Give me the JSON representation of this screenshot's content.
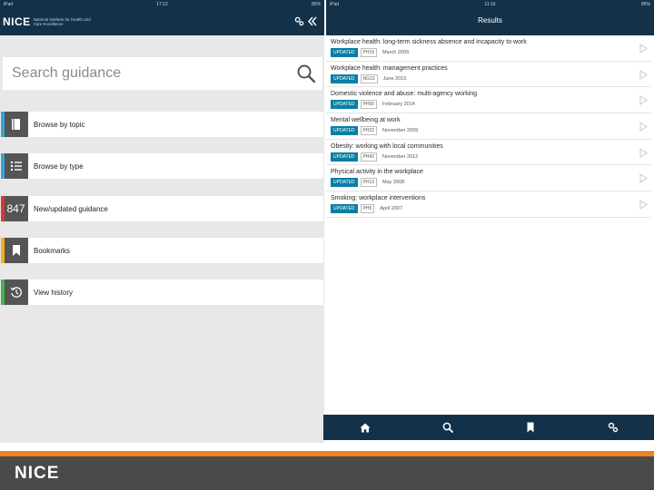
{
  "left": {
    "status": {
      "carrier": "iPad",
      "time": "17:12",
      "battery": "85%"
    },
    "header": {
      "logo": "NICE",
      "logo_sub": "National Institute for Health and Care Excellence"
    },
    "search": {
      "placeholder": "Search guidance"
    },
    "menu": [
      {
        "label": "Browse by topic",
        "icon": "book-icon",
        "accent": "#3aa3d6"
      },
      {
        "label": "Browse by type",
        "icon": "list-icon",
        "accent": "#3aa3d6"
      },
      {
        "label": "New/updated guidance",
        "icon": "count",
        "count": "847",
        "accent": "#d9363e"
      },
      {
        "label": "Bookmarks",
        "icon": "bookmark-icon",
        "accent": "#f2b01e"
      },
      {
        "label": "View history",
        "icon": "history-icon",
        "accent": "#4cae4f"
      }
    ]
  },
  "right": {
    "status": {
      "carrier": "iPad",
      "time": "11:16",
      "battery": "85%"
    },
    "title": "Results",
    "results": [
      {
        "title": "Workplace health: long-term sickness absence and incapacity to work",
        "status": "UPDATED",
        "ref": "PH19",
        "date": "March 2009"
      },
      {
        "title": "Workplace health: management practices",
        "status": "UPDATED",
        "ref": "NG13",
        "date": "June 2015"
      },
      {
        "title": "Domestic violence and abuse: multi-agency working",
        "status": "UPDATED",
        "ref": "PH50",
        "date": "February 2014"
      },
      {
        "title": "Mental wellbeing at work",
        "status": "UPDATED",
        "ref": "PH22",
        "date": "November 2009"
      },
      {
        "title": "Obesity: working with local communities",
        "status": "UPDATED",
        "ref": "PH42",
        "date": "November 2012"
      },
      {
        "title": "Physical activity in the workplace",
        "status": "UPDATED",
        "ref": "PH13",
        "date": "May 2008"
      },
      {
        "title": "Smoking: workplace interventions",
        "status": "UPDATED",
        "ref": "PH5",
        "date": "April 2007"
      }
    ],
    "tabs": [
      "home-icon",
      "search-icon",
      "bookmark-icon",
      "settings-icon"
    ]
  },
  "footer": {
    "logo": "NICE"
  },
  "colors": {
    "navy": "#13324a",
    "teal": "#0a7fa3",
    "orange": "#f58220",
    "footer": "#4a4a4a"
  }
}
